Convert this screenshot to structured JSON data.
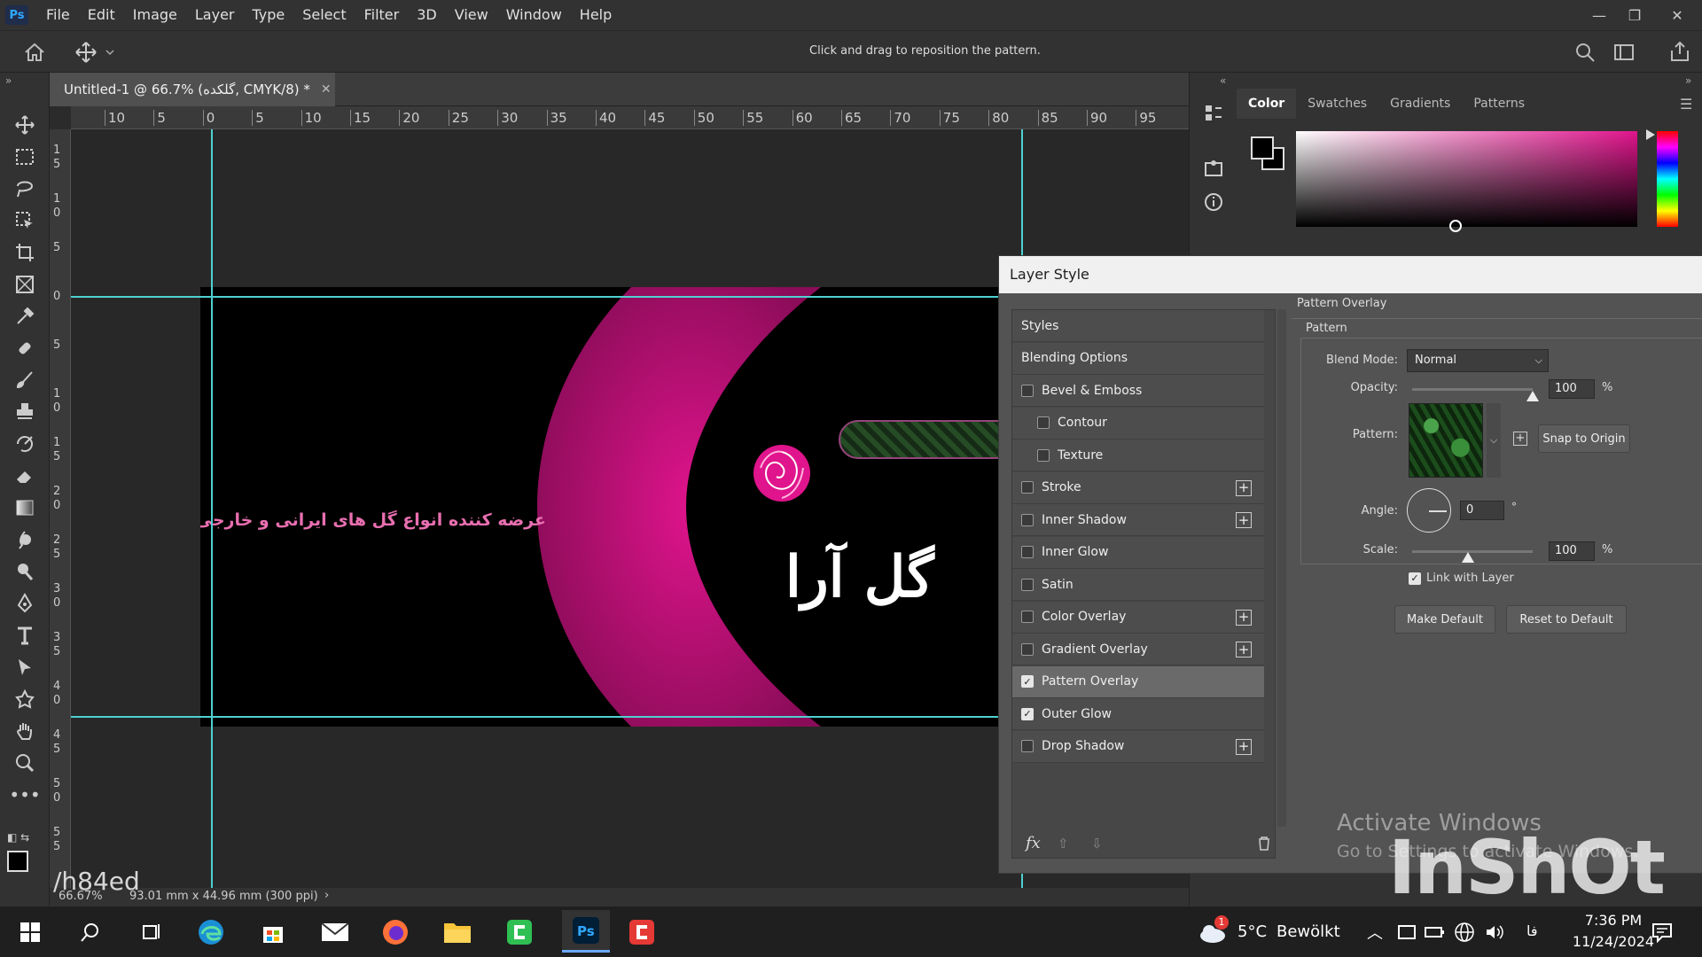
{
  "app": {
    "logo": "Ps",
    "menu": [
      "File",
      "Edit",
      "Image",
      "Layer",
      "Type",
      "Select",
      "Filter",
      "3D",
      "View",
      "Window",
      "Help"
    ]
  },
  "options_bar": {
    "hint": "Click and drag to reposition the pattern."
  },
  "document": {
    "tab_title": "Untitled-1 @ 66.7% (گلکده, CMYK/8) *",
    "status_zoom": "66.67%",
    "status_size": "93.01 mm x 44.96 mm (300 ppi)"
  },
  "ruler": {
    "h_labels": [
      "10",
      "5",
      "0",
      "5",
      "10",
      "15",
      "20",
      "25",
      "30",
      "35",
      "40",
      "45",
      "50",
      "55",
      "60",
      "65",
      "70",
      "75",
      "80",
      "85",
      "90",
      "95"
    ],
    "v_labels": [
      "1\n5",
      "1\n0",
      "5",
      "0",
      "5",
      "1\n0",
      "1\n5",
      "2\n0",
      "2\n5",
      "3\n0",
      "3\n5",
      "4\n0",
      "4\n5",
      "5\n0",
      "5\n5"
    ]
  },
  "artwork": {
    "tagline": "عرضه کننده انواع گل های ایرانی و خارجی",
    "logo_text": "گل آرا",
    "brand_colors": {
      "magenta": "#e0148c",
      "pink_text": "#e86fb0"
    }
  },
  "panels": {
    "tabs": [
      "Color",
      "Swatches",
      "Gradients",
      "Patterns"
    ],
    "active_tab": "Color"
  },
  "layer_style": {
    "title": "Layer Style",
    "styles": [
      {
        "label": "Styles",
        "checkbox": false,
        "plus": false,
        "indent": false,
        "checked": false
      },
      {
        "label": "Blending Options",
        "checkbox": false,
        "plus": false,
        "indent": false,
        "checked": false
      },
      {
        "label": "Bevel & Emboss",
        "checkbox": true,
        "plus": false,
        "indent": false,
        "checked": false
      },
      {
        "label": "Contour",
        "checkbox": true,
        "plus": false,
        "indent": true,
        "checked": false
      },
      {
        "label": "Texture",
        "checkbox": true,
        "plus": false,
        "indent": true,
        "checked": false
      },
      {
        "label": "Stroke",
        "checkbox": true,
        "plus": true,
        "indent": false,
        "checked": false
      },
      {
        "label": "Inner Shadow",
        "checkbox": true,
        "plus": true,
        "indent": false,
        "checked": false
      },
      {
        "label": "Inner Glow",
        "checkbox": true,
        "plus": false,
        "indent": false,
        "checked": false
      },
      {
        "label": "Satin",
        "checkbox": true,
        "plus": false,
        "indent": false,
        "checked": false
      },
      {
        "label": "Color Overlay",
        "checkbox": true,
        "plus": true,
        "indent": false,
        "checked": false
      },
      {
        "label": "Gradient Overlay",
        "checkbox": true,
        "plus": true,
        "indent": false,
        "checked": false
      },
      {
        "label": "Pattern Overlay",
        "checkbox": true,
        "plus": false,
        "indent": false,
        "checked": true,
        "selected": true
      },
      {
        "label": "Outer Glow",
        "checkbox": true,
        "plus": false,
        "indent": false,
        "checked": true
      },
      {
        "label": "Drop Shadow",
        "checkbox": true,
        "plus": true,
        "indent": false,
        "checked": false
      }
    ],
    "pattern_overlay": {
      "section_title": "Pattern Overlay",
      "group_title": "Pattern",
      "blend_mode_label": "Blend Mode:",
      "blend_mode": "Normal",
      "opacity_label": "Opacity:",
      "opacity": "100",
      "opacity_level": 100,
      "pattern_label": "Pattern:",
      "snap_button": "Snap to Origin",
      "angle_label": "Angle:",
      "angle": "0",
      "degree_symbol": "°",
      "scale_label": "Scale:",
      "scale": "100",
      "scale_level": 100,
      "percent": "%",
      "link_label": "Link with Layer",
      "link_checked": true,
      "make_default": "Make Default",
      "reset_default": "Reset to Default"
    },
    "footer": {
      "fx": "fx"
    }
  },
  "watermarks": {
    "activate_title": "Activate Windows",
    "activate_sub": "Go to Settings to activate Windows.",
    "inshot": "InShOt",
    "user_tag": "/h84ed"
  },
  "taskbar": {
    "weather_temp": "5°C",
    "weather_text": "Bewölkt",
    "weather_badge": "1",
    "lang": "فا",
    "time": "7:36 PM",
    "date": "11/24/2024"
  }
}
